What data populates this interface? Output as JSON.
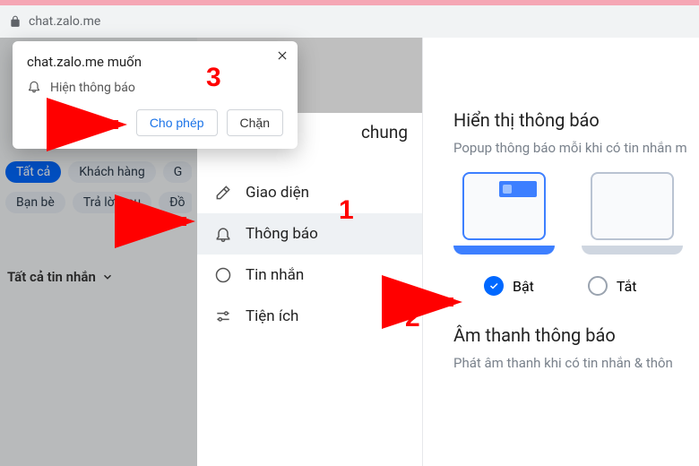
{
  "address_bar": {
    "url": "chat.zalo.me"
  },
  "permission_popup": {
    "title": "chat.zalo.me muốn",
    "option": "Hiện thông báo",
    "allow": "Cho phép",
    "block": "Chặn"
  },
  "left": {
    "row1": [
      "Tất cả",
      "Khách hàng",
      "G"
    ],
    "row2": [
      "Bạn bè",
      "Trả lời sau",
      "Đồ"
    ],
    "all_messages": "Tất cả tin nhắn"
  },
  "settings_nav": {
    "header": "chung",
    "items": [
      {
        "key": "interface",
        "label": "Giao diện"
      },
      {
        "key": "notifications",
        "label": "Thông báo"
      },
      {
        "key": "messages",
        "label": "Tin nhắn"
      },
      {
        "key": "utilities",
        "label": "Tiện ích"
      }
    ]
  },
  "right": {
    "section1_title": "Hiển thị thông báo",
    "section1_sub": "Popup thông báo mỗi khi có tin nhắn m",
    "opt_on": "Bật",
    "opt_off": "Tắt",
    "section2_title": "Âm thanh thông báo",
    "section2_sub": "Phát âm thanh khi có tin nhắn & thôn"
  },
  "annotations": {
    "n1": "1",
    "n2": "2",
    "n3": "3"
  }
}
